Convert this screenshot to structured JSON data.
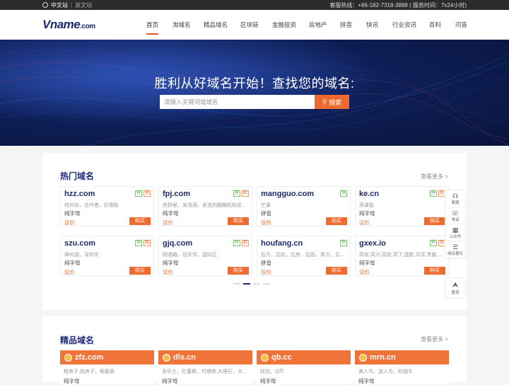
{
  "topbar": {
    "lang_cn": "中文站",
    "lang_sep": "|",
    "lang_en": "英文站",
    "hotline": "客服热线：+86-182-7318-3888 ( 服务时间：7x24小时)"
  },
  "logo": {
    "text": "Vname",
    "suffix": ".com"
  },
  "menu": [
    "首页",
    "淘域名",
    "精品域名",
    "区块链",
    "金融投资",
    "房地产",
    "拼音",
    "快讯",
    "行业资讯",
    "百科",
    "问答"
  ],
  "hero": {
    "title": "胜利从好域名开始！查找您的域名:",
    "search_placeholder": "请输入关键词或域名",
    "search_button": "搜索"
  },
  "hot": {
    "title": "热门域名",
    "more": "查看更多 >",
    "items": [
      {
        "name": "hzz.com",
        "desc": "杭州站，合作者，好做账",
        "type": "纯字母",
        "tags": [
          "荐",
          "精"
        ],
        "price": "议价",
        "buy": "购买"
      },
      {
        "name": "fpj.com",
        "desc": "房拼居，发泡酒，发泡剂翻糖机粉皮...",
        "type": "纯字母",
        "tags": [
          "荐",
          "精"
        ],
        "price": "议价",
        "buy": "购买"
      },
      {
        "name": "mangguo.com",
        "desc": "芒果",
        "type": "拼音",
        "tags": [
          "荐"
        ],
        "price": "议价",
        "buy": "购买"
      },
      {
        "name": "ke.cn",
        "desc": "壳课氪",
        "type": "纯字母",
        "tags": [
          "荐",
          "精"
        ],
        "price": "议价",
        "buy": "购买"
      },
      {
        "name": "szu.com",
        "desc": "神州游，深圳优",
        "type": "纯字母",
        "tags": [
          "荐",
          "精"
        ],
        "price": "议价",
        "buy": "购买"
      },
      {
        "name": "gjq.com",
        "desc": "购酒趣，冠军传，国际区",
        "type": "纯字母",
        "tags": [
          "荐",
          "精"
        ],
        "price": "议价",
        "buy": "购买"
      },
      {
        "name": "houfang.cn",
        "desc": "后方，后防，后房，后肪，厚方，后...",
        "type": "拼音",
        "tags": [
          "荐"
        ],
        "price": "议价",
        "buy": "购买"
      },
      {
        "name": "gxex.io",
        "desc": "高效,高兴,高校,高下,国新,共享,贵献,...",
        "type": "纯字母",
        "tags": [
          "荐",
          "精"
        ],
        "price": "议价",
        "buy": "购买"
      }
    ]
  },
  "premium": {
    "title": "精品域名",
    "more": "查看更多 >",
    "items": [
      {
        "name": "zfz.com",
        "desc": "租房子,找房子，租服装",
        "type": "纯字母"
      },
      {
        "name": "dls.cn",
        "desc": "多乐士，杜蕾斯，代理商,大理石，大...",
        "type": "纯字母"
      },
      {
        "name": "qb.cc",
        "desc": "钱包，Q币",
        "type": "纯字母"
      },
      {
        "name": "mrn.cn",
        "desc": "美人鸟，迷人鸟，秒融牛",
        "type": "纯字母"
      }
    ]
  },
  "float_bar": {
    "items": [
      "客服",
      "电话",
      "公众号",
      "域名委托"
    ],
    "totop": "置顶"
  },
  "colors": {
    "accent": "#ef6a2e",
    "brand": "#1f2a7a",
    "hero_bg": "#0e1f58"
  }
}
